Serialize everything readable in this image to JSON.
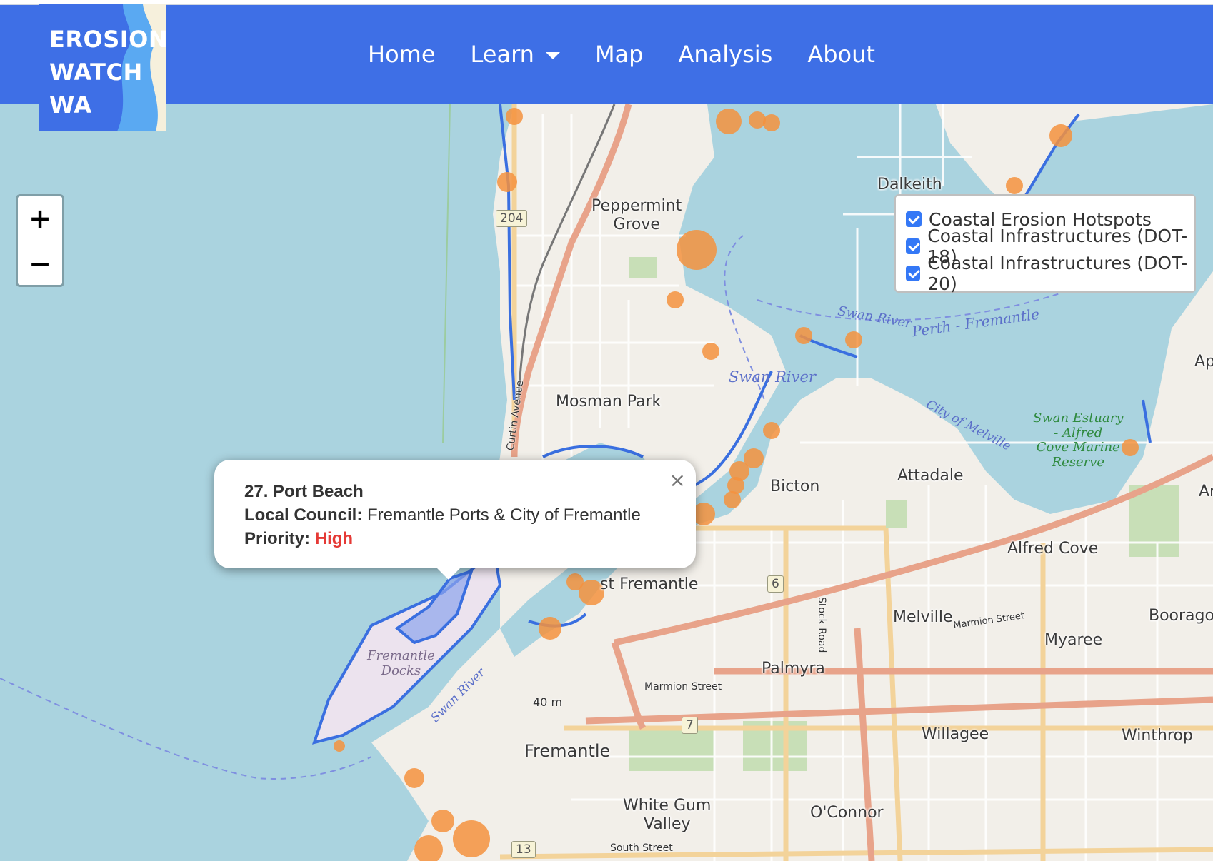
{
  "brand": {
    "logo_text": "EROSION\nWATCH\nWA"
  },
  "nav": {
    "items": [
      {
        "label": "Home"
      },
      {
        "label": "Learn",
        "dropdown": true
      },
      {
        "label": "Map"
      },
      {
        "label": "Analysis"
      },
      {
        "label": "About"
      }
    ]
  },
  "zoom": {
    "in": "+",
    "out": "−"
  },
  "layers": {
    "items": [
      {
        "label": "Coastal Erosion Hotspots",
        "checked": true
      },
      {
        "label": "Coastal Infrastructures (DOT-18)",
        "checked": true
      },
      {
        "label": "Coastal Infrastructures (DOT-20)",
        "checked": true
      }
    ]
  },
  "popup": {
    "title": "27. Port Beach",
    "council_label": "Local Council:",
    "council_value": "Fremantle Ports & City of Fremantle",
    "priority_label": "Priority:",
    "priority_value": "High",
    "priority_color": "#e53935",
    "close": "×"
  },
  "map": {
    "places": {
      "dalkeith": "Dalkeith",
      "peppermint_grove": "Peppermint\nGrove",
      "mosman_park": "Mosman Park",
      "bicton": "Bicton",
      "attadale": "Attadale",
      "alfred_cove": "Alfred Cove",
      "east_fremantle": "st Fremantle",
      "melville": "Melville",
      "myaree": "Myaree",
      "palmyra": "Palmyra",
      "willagee": "Willagee",
      "winthrop": "Winthrop",
      "fremantle": "Fremantle",
      "white_gum_valley": "White Gum\nValley",
      "oconnor": "O'Connor",
      "booragoon": "Booragoo",
      "applecross": "Appl",
      "ardross": "Ardr"
    },
    "water": {
      "swan_river_1": "Swan River",
      "perth_fremantle": "Perth - Fremantle",
      "swan_river_2": "Swan River",
      "city_of_melville": "City of Melville",
      "fremantle_docks": "Fremantle\nDocks",
      "swan_river_3": "Swan River"
    },
    "park": {
      "swan_estuary": "Swan Estuary\n- Alfred\nCove Marine\nReserve"
    },
    "roads": {
      "curtin_avenue": "Curtin Avenue",
      "stock_road": "Stock Road",
      "marmion_street_1": "Marmion Street",
      "marmion_street_2": "Marmion Street",
      "south_street": "South Street",
      "elevation": "40 m"
    },
    "shields": {
      "r204": "204",
      "r6": "6",
      "r7": "7",
      "r13": "13"
    },
    "colors": {
      "water": "#aad3df",
      "land": "#f2efe9",
      "primary_road": "#e8a38a",
      "secondary_road": "#f3d39a",
      "hotspot": "#f5923e",
      "infrastructure": "#3a6fe0"
    }
  }
}
